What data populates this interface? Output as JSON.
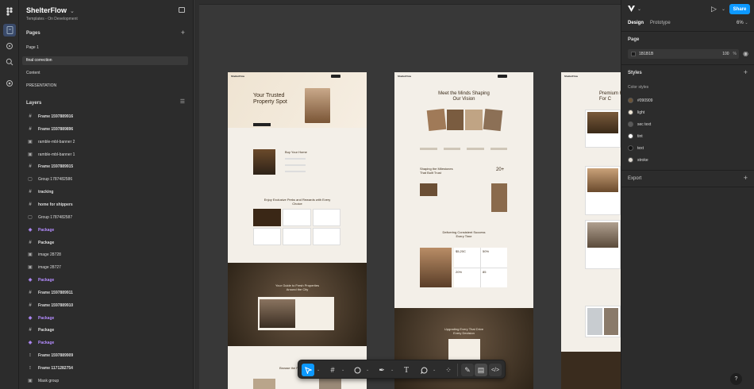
{
  "project": {
    "title": "ShelterFlow",
    "subtitle": "Templates - On Development"
  },
  "pages": {
    "header": "Pages",
    "items": [
      {
        "label": "Page 1"
      },
      {
        "label": "final correction"
      },
      {
        "label": "Content"
      },
      {
        "label": "PRESENTATION"
      }
    ]
  },
  "layers": {
    "header": "Layers",
    "items": [
      {
        "label": "Frame 1597889916",
        "icon": "#"
      },
      {
        "label": "Frame 1597889896",
        "icon": "#"
      },
      {
        "label": "ramble-mbl-banner 2",
        "icon": "▣"
      },
      {
        "label": "ramble-mbl-banner 1",
        "icon": "▣"
      },
      {
        "label": "Frame 1597889915",
        "icon": "#"
      },
      {
        "label": "Group 1787482586",
        "icon": "▢"
      },
      {
        "label": "tracking",
        "icon": "#"
      },
      {
        "label": "home for shippers",
        "icon": "#"
      },
      {
        "label": "Group 1787482587",
        "icon": "▢"
      },
      {
        "label": "Package",
        "icon": "◈"
      },
      {
        "label": "Package",
        "icon": "#"
      },
      {
        "label": "image 28728",
        "icon": "▣"
      },
      {
        "label": "image 28727",
        "icon": "▣"
      },
      {
        "label": "Package",
        "icon": "◈"
      },
      {
        "label": "Frame 1597889911",
        "icon": "#"
      },
      {
        "label": "Frame 1597889910",
        "icon": "#"
      },
      {
        "label": "Package",
        "icon": "◈"
      },
      {
        "label": "Package",
        "icon": "#"
      },
      {
        "label": "Package",
        "icon": "◈"
      },
      {
        "label": "Frame 1597889909",
        "icon": "⁝"
      },
      {
        "label": "Frame 1171282754",
        "icon": "⁝"
      },
      {
        "label": "Mask group",
        "icon": "▣"
      }
    ]
  },
  "right": {
    "tab_design": "Design",
    "tab_prototype": "Prototype",
    "zoom": "6%",
    "share": "Share",
    "page_header": "Page",
    "page_color": "1B1B1B",
    "page_opacity": "100",
    "page_pct": "%",
    "styles_header": "Styles",
    "color_styles": "Color styles",
    "styles": [
      {
        "name": "#090909",
        "color": "#6b5438"
      },
      {
        "name": "light",
        "color": "#efe6d6"
      },
      {
        "name": "sec text",
        "color": "#5a5a5a"
      },
      {
        "name": "tint",
        "color": "#ffffff"
      },
      {
        "name": "text",
        "color": "#121212"
      },
      {
        "name": "stroke",
        "color": "#e0dbd3"
      }
    ],
    "export_header": "Export"
  },
  "design": {
    "f1_brand": "ShelterFlow",
    "f1_hero": "Your Trusted Property Spot",
    "f1_buy": "Buy Your Home",
    "f1_enjoy": "Enjoy Exclusive Perks and Rewards with Every Choice",
    "f1_guide": "Your Guide to Fresh Properties Around the City",
    "f1_browse": "Browse the Properties by",
    "f2_brand": "ShelterFlow",
    "f2_hero": "Meet the Minds Shaping Our Vision",
    "f2_shape": "Shaping the Milestones That Built Trust",
    "f2_count": "20+",
    "f2_deliver": "Delivering Consistent Success Every Time",
    "f2_upgrade": "Upgrading Every That Drive Every Decision",
    "f2_stats": [
      "$5,20C",
      "50%",
      "20%",
      "85"
    ],
    "f3_brand": "ShelterFlow",
    "f3_hero": "Premium Hom For C"
  },
  "colors": {
    "accent": "#0d99ff",
    "component": "#b48cff",
    "panel": "#2c2c2c",
    "canvas": "#383838"
  }
}
